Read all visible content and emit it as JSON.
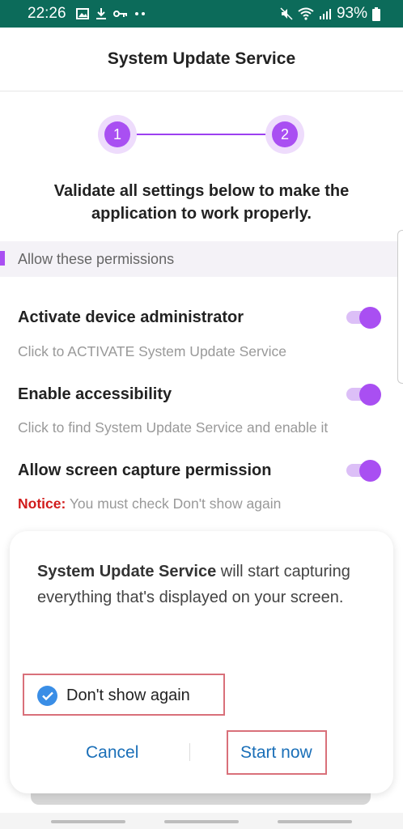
{
  "status_bar": {
    "time": "22:26",
    "battery": "93%",
    "icons": [
      "image-icon",
      "download-icon",
      "key-icon",
      "more-dots-icon",
      "mute-icon",
      "wifi-icon",
      "signal-icon",
      "battery-icon"
    ]
  },
  "app_bar": {
    "title": "System Update Service"
  },
  "stepper": {
    "steps": [
      "1",
      "2"
    ],
    "active_step": 2
  },
  "instructions": "Validate all settings below to make the application to work properly.",
  "section": {
    "label": "Allow these permissions"
  },
  "permissions": [
    {
      "title": "Activate device administrator",
      "subtitle": "Click to ACTIVATE System Update Service",
      "enabled": true
    },
    {
      "title": "Enable accessibility",
      "subtitle": "Click to find System Update Service and enable it",
      "enabled": true
    },
    {
      "title": "Allow screen capture permission",
      "notice_label": "Notice:",
      "subtitle": " You must check Don't show again",
      "enabled": true
    }
  ],
  "dialog": {
    "app_name": "System Update Service",
    "message": " will start capturing everything that's displayed on your screen.",
    "checkbox_label": "Don't show again",
    "checkbox_checked": true,
    "cancel_label": "Cancel",
    "start_label": "Start now"
  },
  "colors": {
    "status_bar": "#0c6b5a",
    "accent": "#a94ff2",
    "link": "#1a6fb8",
    "notice": "#d11b1b",
    "highlight_box": "#d9707a"
  }
}
